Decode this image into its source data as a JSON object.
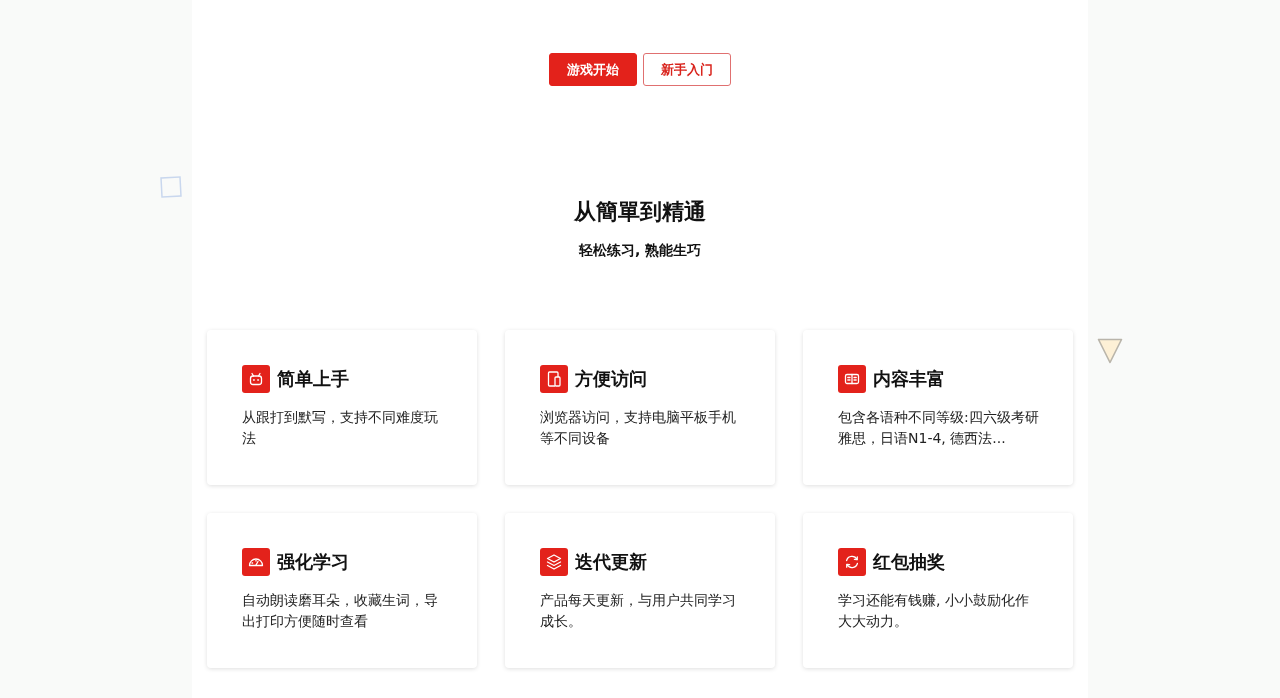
{
  "actions": [
    {
      "label": "游戏开始",
      "kind": "primary"
    },
    {
      "label": "新手入门",
      "kind": "outline"
    }
  ],
  "heading": {
    "title": "从簡單到精通",
    "subtitle": "轻松练习, 熟能生巧"
  },
  "features": [
    {
      "title": "简单上手",
      "description": "从跟打到默写，支持不同难度玩法"
    },
    {
      "title": "方便访问",
      "description": "浏览器访问，支持电脑平板手机等不同设备"
    },
    {
      "title": "内容丰富",
      "description": "包含各语种不同等级:四六级考研雅思，日语N1-4, 德西法..."
    },
    {
      "title": "强化学习",
      "description": "自动朗读磨耳朵，收藏生词，导出打印方便随时查看"
    },
    {
      "title": "迭代更新",
      "description": "产品每天更新，与用户共同学习成长。"
    },
    {
      "title": "红包抽奖",
      "description": "学习还能有钱赚, 小小鼓励化作大大动力。"
    }
  ]
}
